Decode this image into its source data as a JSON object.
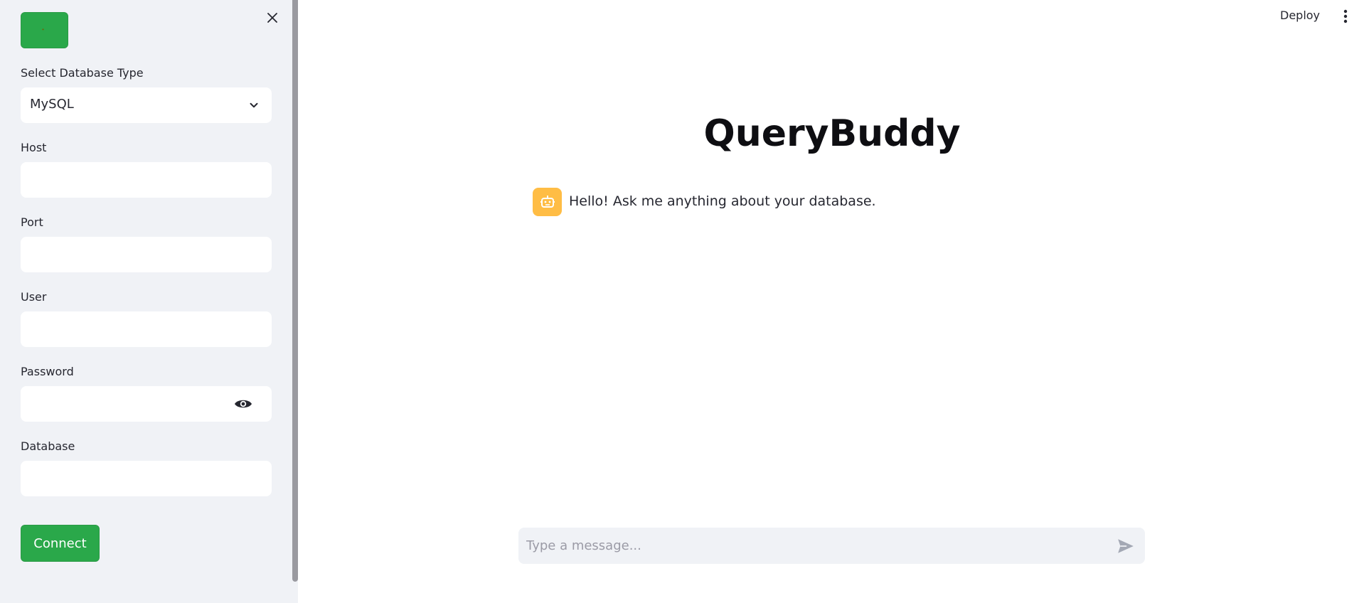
{
  "sidebar": {
    "theme_toggle_icon": "moon-icon",
    "close_icon": "close-icon",
    "db_type": {
      "label": "Select Database Type",
      "value": "MySQL"
    },
    "host": {
      "label": "Host",
      "value": ""
    },
    "port": {
      "label": "Port",
      "value": ""
    },
    "user": {
      "label": "User",
      "value": ""
    },
    "password": {
      "label": "Password",
      "value": ""
    },
    "database": {
      "label": "Database",
      "value": ""
    },
    "connect_label": "Connect"
  },
  "header": {
    "deploy_label": "Deploy",
    "menu_icon": "kebab-menu-icon"
  },
  "main": {
    "title": "QueryBuddy",
    "messages": [
      {
        "role": "assistant",
        "avatar_icon": "robot-icon",
        "text": "Hello! Ask me anything about your database."
      }
    ]
  },
  "chat_input": {
    "placeholder": "Type a message...",
    "send_icon": "send-icon"
  },
  "colors": {
    "accent_green": "#2aa84a",
    "sidebar_bg": "#f0f2f6",
    "bot_avatar": "#ffbd45"
  }
}
